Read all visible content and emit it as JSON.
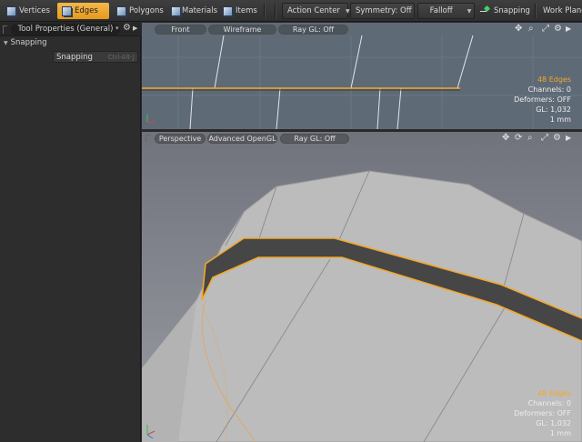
{
  "toolbar": {
    "modes": [
      {
        "label": "Vertices",
        "icon": "vertices-icon",
        "active": false
      },
      {
        "label": "Edges",
        "icon": "edges-icon",
        "active": true
      },
      {
        "label": "Polygons",
        "icon": "polygons-icon",
        "active": false
      },
      {
        "label": "Materials",
        "icon": "materials-icon",
        "active": false
      },
      {
        "label": "Items",
        "icon": "items-icon",
        "active": false
      }
    ],
    "action_center": "Action Center",
    "symmetry": "Symmetry: Off",
    "falloff": "Falloff",
    "snapping": "Snapping",
    "work_plane": "Work Plane"
  },
  "left_panel": {
    "title": "Tool Properties (General)",
    "section": "Snapping",
    "row_label": "Snapping",
    "row_hotkey": "Ctrl-Alt-J"
  },
  "viewport_top": {
    "view": "Front",
    "shading": "Wireframe",
    "raygl": "Ray GL: Off",
    "info": {
      "selection": "48 Edges",
      "channels": "Channels: 0",
      "deformers": "Deformers: OFF",
      "gl": "GL: 1,032",
      "scale": "1 mm"
    }
  },
  "viewport_bottom": {
    "view": "Perspective",
    "shading": "Advanced OpenGL",
    "raygl": "Ray GL: Off",
    "info": {
      "selection": "48 Edges",
      "channels": "Channels: 0",
      "deformers": "Deformers: OFF",
      "gl": "GL: 1,032",
      "scale": "1 mm"
    }
  },
  "colors": {
    "accent": "#f2a72c",
    "viewport_bg_top": "#5f6a77",
    "viewport_bg_bottom": "#8d8f97",
    "mesh_surface": "#b9b9b9",
    "selected_band": "#464646"
  }
}
